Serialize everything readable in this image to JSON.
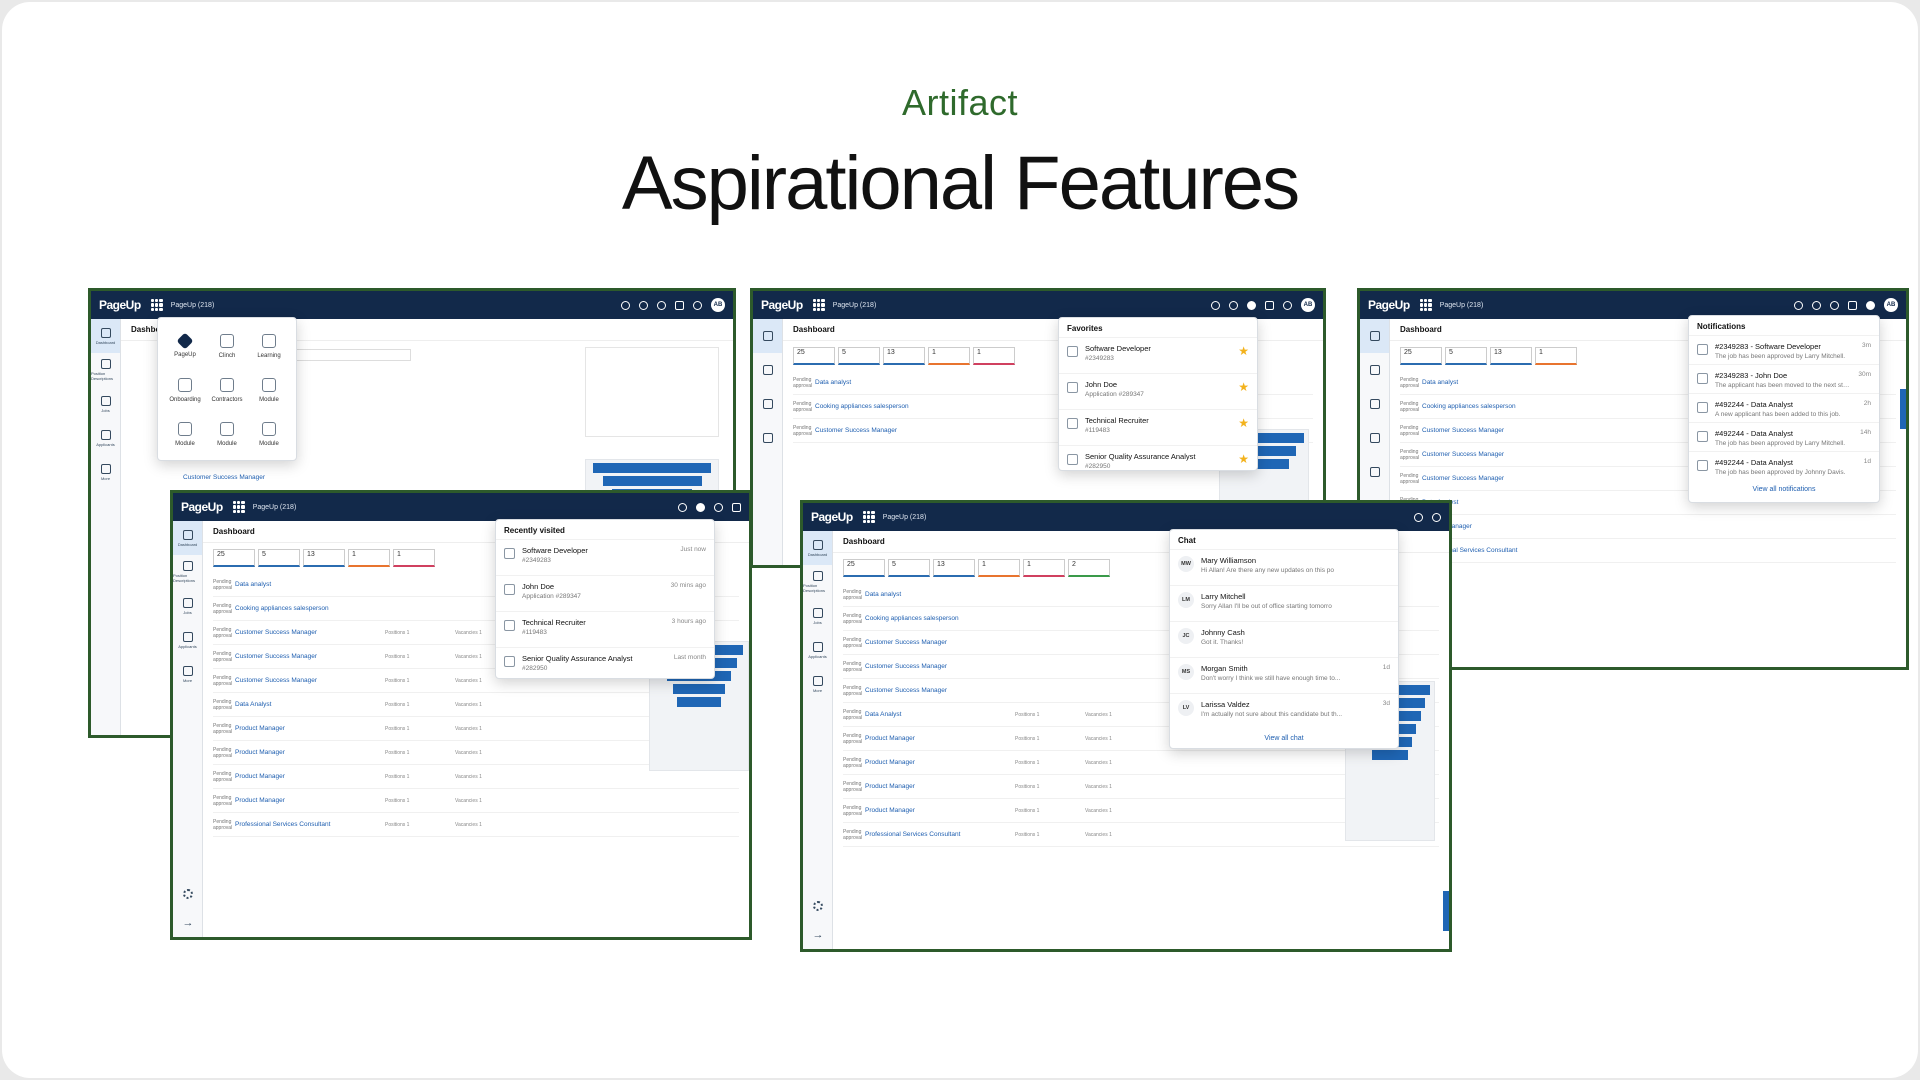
{
  "slide": {
    "kicker": "Artifact",
    "title": "Aspirational Features"
  },
  "app": {
    "logo": "PageUp",
    "tenant": "PageUp (218)",
    "avatar": "AB",
    "dashboard_title": "Dashboard",
    "nav": [
      "Dashboard",
      "Position Descriptions",
      "Jobs",
      "Applicants",
      "More"
    ],
    "tiles": [
      "25",
      "5",
      "13",
      "1",
      "1",
      "2",
      "1",
      "2"
    ],
    "jobs": [
      "Data analyst",
      "Cooking appliances salesperson",
      "Customer Success Manager",
      "Customer Success Manager",
      "Customer Success Manager",
      "Data Analyst",
      "Product Manager",
      "Product Manager",
      "Product Manager",
      "Product Manager",
      "Professional Services Consultant"
    ],
    "pending_label": "Pending approval",
    "positions_label": "Positions 1",
    "vacancies_label": "Vacancies 1"
  },
  "apps_menu": {
    "items": [
      "PageUp",
      "Clinch",
      "Learning",
      "Onboarding",
      "Contractors",
      "Module",
      "Module",
      "Module",
      "Module"
    ]
  },
  "recently_visited": {
    "title": "Recently visited",
    "items": [
      {
        "name": "Software Developer",
        "sub": "#2349283",
        "time": "Just now"
      },
      {
        "name": "John Doe",
        "sub": "Application #289347",
        "time": "30 mins ago"
      },
      {
        "name": "Technical Recruiter",
        "sub": "#119483",
        "time": "3 hours ago"
      },
      {
        "name": "Senior Quality Assurance Analyst",
        "sub": "#282950",
        "time": "Last month"
      }
    ]
  },
  "favorites": {
    "title": "Favorites",
    "items": [
      {
        "name": "Software Developer",
        "sub": "#2349283"
      },
      {
        "name": "John Doe",
        "sub": "Application #289347"
      },
      {
        "name": "Technical Recruiter",
        "sub": "#119483"
      },
      {
        "name": "Senior Quality Assurance Analyst",
        "sub": "#282950"
      }
    ]
  },
  "chat": {
    "title": "Chat",
    "items": [
      {
        "initials": "MW",
        "name": "Mary Williamson",
        "msg": "Hi Allan! Are there any new updates on this po",
        "time": ""
      },
      {
        "initials": "LM",
        "name": "Larry Mitchell",
        "msg": "Sorry Allan I'll be out of office starting tomorro",
        "time": ""
      },
      {
        "initials": "JC",
        "name": "Johnny Cash",
        "msg": "Got it. Thanks!",
        "time": ""
      },
      {
        "initials": "MS",
        "name": "Morgan Smith",
        "msg": "Don't worry I think we still have enough time to...",
        "time": "1d"
      },
      {
        "initials": "LV",
        "name": "Larissa Valdez",
        "msg": "I'm actually not sure about this candidate but th...",
        "time": "3d"
      }
    ],
    "view_all": "View all chat"
  },
  "notifications": {
    "title": "Notifications",
    "items": [
      {
        "name": "#2349283 - Software Developer",
        "sub": "The job has been approved by Larry Mitchell.",
        "time": "3m"
      },
      {
        "name": "#2349283 - John Doe",
        "sub": "The applicant has been moved to the next step.",
        "time": "30m"
      },
      {
        "name": "#492244 - Data Analyst",
        "sub": "A new applicant has been added to this job.",
        "time": "2h"
      },
      {
        "name": "#492244 - Data Analyst",
        "sub": "The job has been approved by Larry Mitchell.",
        "time": "14h"
      },
      {
        "name": "#492244 - Data Analyst",
        "sub": "The job has been approved by Johnny Davis.",
        "time": "1d"
      }
    ],
    "view_all": "View all notifications"
  },
  "colors": {
    "topbar": "#12294a",
    "frame": "#2d5a2b",
    "kicker": "#2f6a2c",
    "link": "#1f5fb0",
    "star": "#f3b21c"
  }
}
